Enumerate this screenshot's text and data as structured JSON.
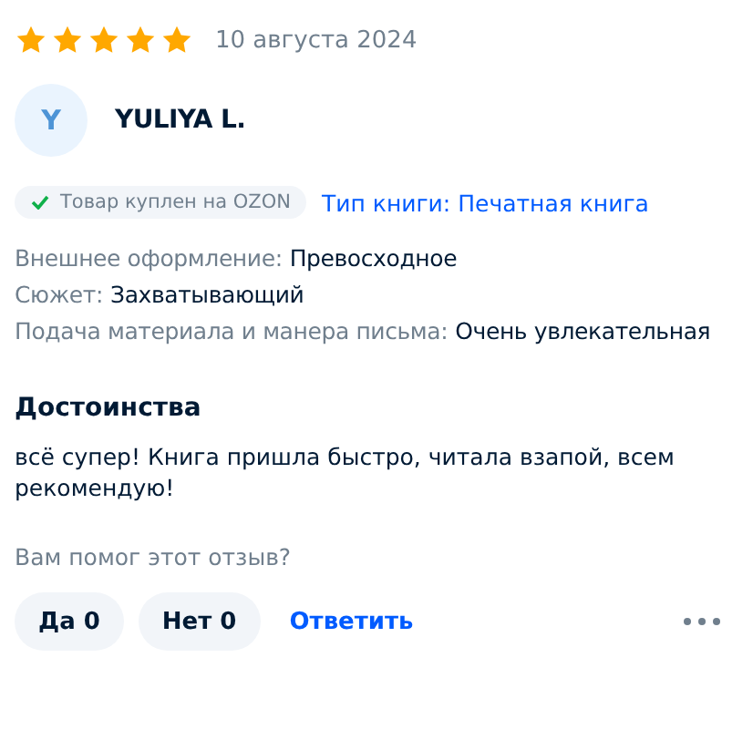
{
  "review": {
    "stars": 5,
    "date": "10 августа 2024",
    "author": {
      "initial": "Y",
      "name": "YULIYA L."
    },
    "purchase_badge": "Товар куплен на OZON",
    "book_type_link": "Тип книги: Печатная книга",
    "attributes": [
      {
        "label": "Внешнее оформление:",
        "value": "Превосходное"
      },
      {
        "label": "Сюжет:",
        "value": "Захватывающий"
      },
      {
        "label": "Подача материала и манера письма:",
        "value": "Очень увлекательная"
      }
    ],
    "section_title": "Достоинства",
    "text": "всё супер! Книга пришла быстро, читала взапой, всем рекомендую!",
    "helpful_question": "Вам помог этот отзыв?",
    "votes": [
      {
        "label": "Да 0"
      },
      {
        "label": "Нет 0"
      }
    ],
    "reply_link": "Ответить"
  }
}
